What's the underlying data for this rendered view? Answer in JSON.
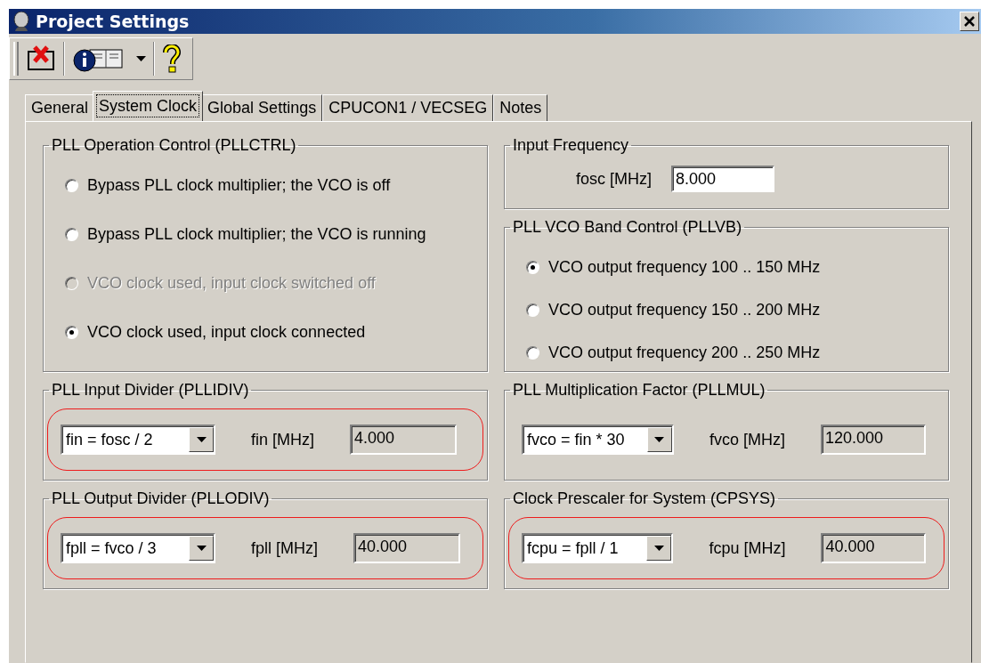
{
  "window": {
    "title": "Project Settings"
  },
  "tabs": [
    {
      "label": "General",
      "selected": false
    },
    {
      "label": "System Clock",
      "selected": true
    },
    {
      "label": "Global Settings",
      "selected": false
    },
    {
      "label": "CPUCON1 / VECSEG",
      "selected": false
    },
    {
      "label": "Notes",
      "selected": false
    }
  ],
  "pll_operation_control": {
    "title": "PLL Operation Control (PLLCTRL)",
    "options": [
      {
        "label": "Bypass PLL clock multiplier; the VCO is off",
        "selected": false,
        "disabled": false
      },
      {
        "label": "Bypass PLL clock multiplier; the VCO is running",
        "selected": false,
        "disabled": false
      },
      {
        "label": "VCO clock used, input clock switched off",
        "selected": false,
        "disabled": true
      },
      {
        "label": "VCO clock used, input clock connected",
        "selected": true,
        "disabled": false
      }
    ]
  },
  "input_frequency": {
    "title": "Input Frequency",
    "label": "fosc [MHz]",
    "value": "8.000"
  },
  "pll_vco_band_control": {
    "title": "PLL VCO Band Control (PLLVB)",
    "options": [
      {
        "label": "VCO output frequency 100 .. 150 MHz",
        "selected": true,
        "disabled": false
      },
      {
        "label": "VCO output frequency 150 .. 200 MHz",
        "selected": false,
        "disabled": false
      },
      {
        "label": "VCO output frequency 200 .. 250 MHz",
        "selected": false,
        "disabled": false
      }
    ]
  },
  "divider_groups": [
    {
      "title": "PLL Input Divider (PLLIDIV)",
      "select": "fin = fosc / 2",
      "label": "fin [MHz]",
      "value": "4.000",
      "highlighted": true
    },
    {
      "title": "PLL Multiplication Factor (PLLMUL)",
      "select": "fvco = fin * 30",
      "label": "fvco [MHz]",
      "value": "120.000",
      "highlighted": false
    },
    {
      "title": "PLL Output Divider (PLLODIV)",
      "select": "fpll = fvco / 3",
      "label": "fpll [MHz]",
      "value": "40.000",
      "highlighted": true
    },
    {
      "title": "Clock Prescaler for System (CPSYS)",
      "select": "fcpu = fpll / 1",
      "label": "fcpu [MHz]",
      "value": "40.000",
      "highlighted": true
    }
  ]
}
